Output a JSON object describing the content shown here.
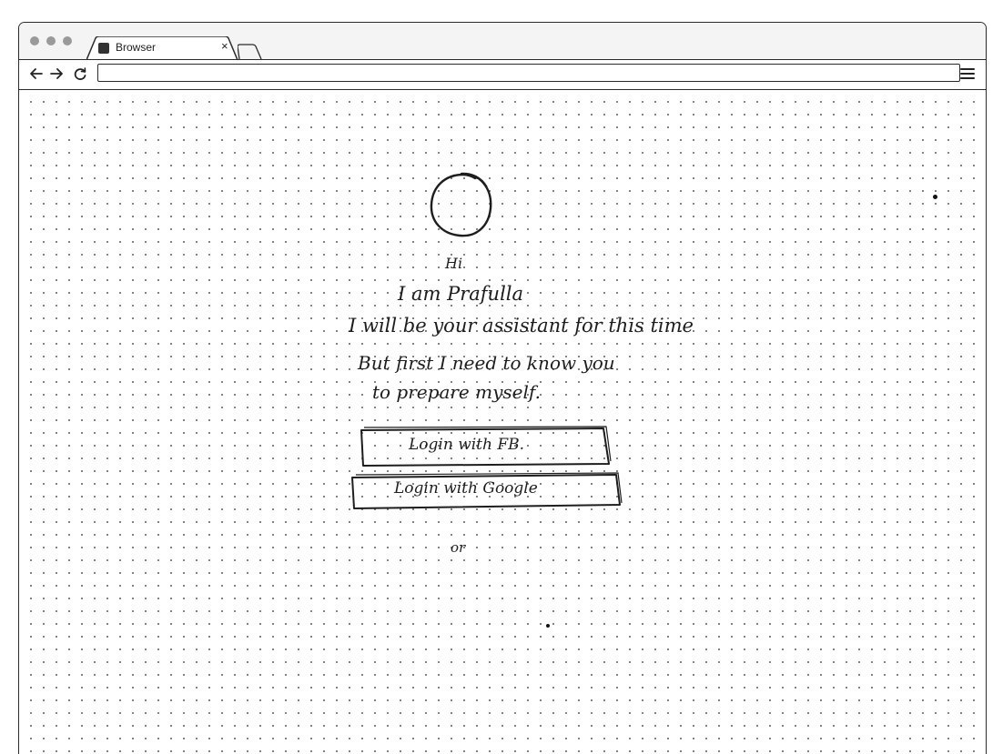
{
  "browser": {
    "tab_title": "Browser",
    "tab_close": "×",
    "url": ""
  },
  "icons": {
    "back": "arrow-left-icon",
    "forward": "arrow-right-icon",
    "reload": "reload-icon",
    "menu": "hamburger-menu-icon",
    "avatar": "avatar-circle"
  },
  "content": {
    "greeting": "Hi",
    "intro": "I am Prafulla",
    "assist_line": "I will be your assistant for this time",
    "need_line_1": "But first I need to know you",
    "need_line_2": "to prepare myself.",
    "login_fb_label": "Login with FB.",
    "login_google_label": "Login with Google",
    "or_label": "or"
  },
  "colors": {
    "ink": "#1d1d1d",
    "paper": "#ffffff",
    "dots": "#6f6f6f"
  }
}
